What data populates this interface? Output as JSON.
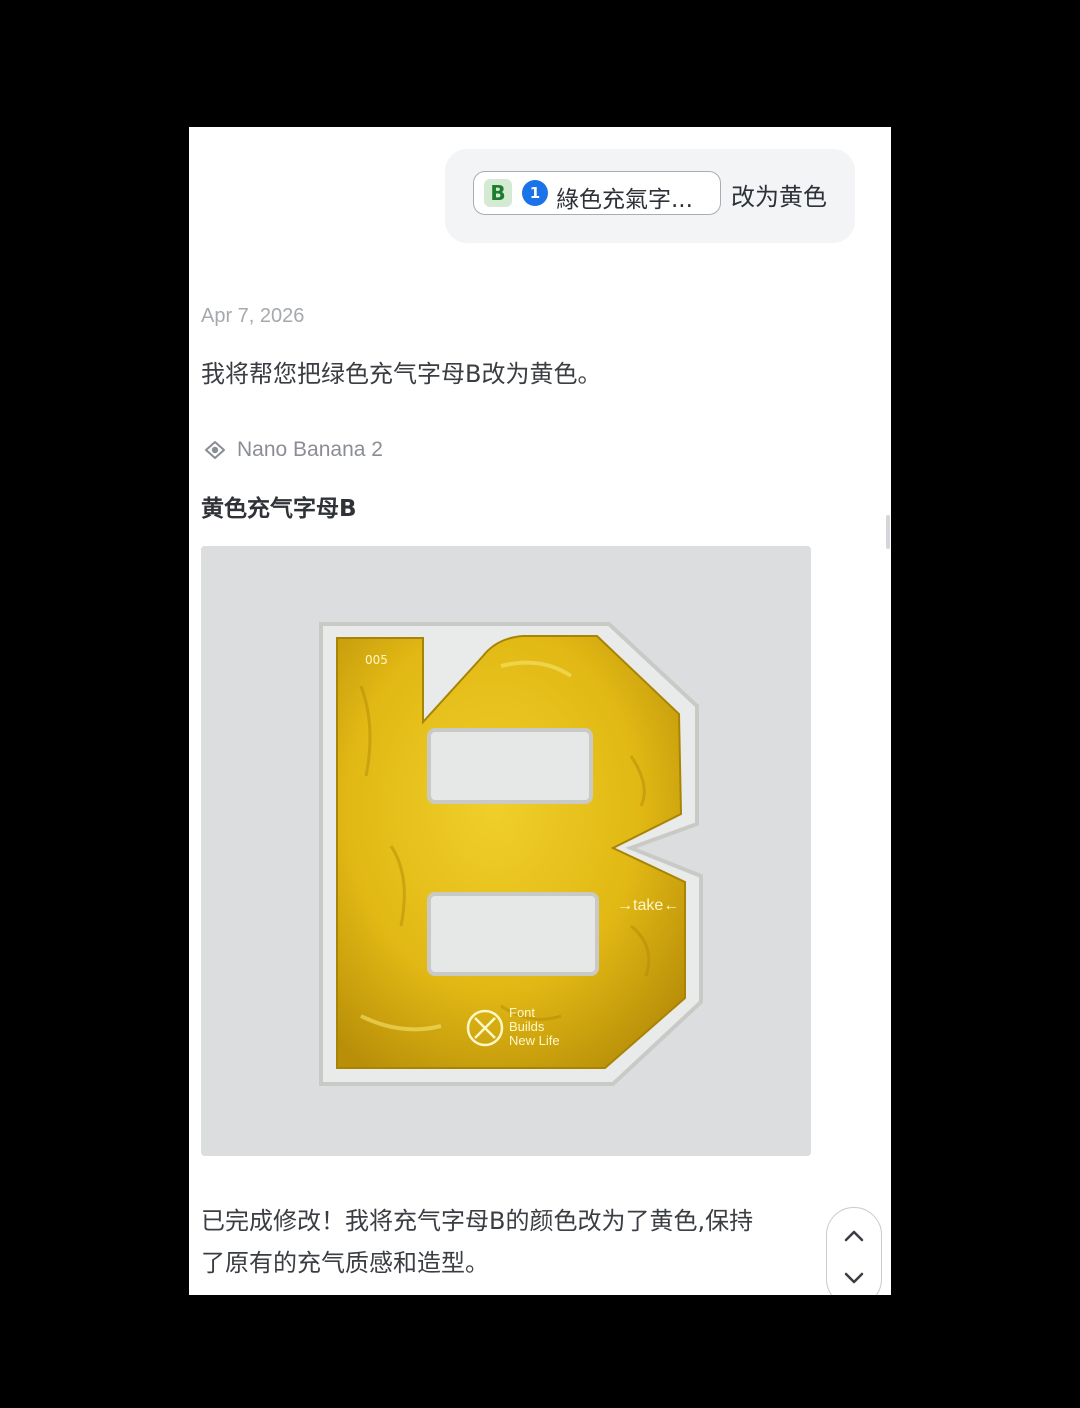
{
  "user_message": {
    "attachment": {
      "thumb_letter": "B",
      "index": "1",
      "label": "綠色充氣字..."
    },
    "text": "改为黄色"
  },
  "assistant": {
    "date": "Apr 7, 2026",
    "reply_intro": "我将帮您把绿色充气字母B改为黄色。",
    "model_name": "Nano Banana 2",
    "image_card_title": "黄色充气字母B",
    "image": {
      "subject": "yellow inflatable letter B",
      "tag_number": "005",
      "tag_take": "→take←",
      "badge_lines": [
        "Font",
        "Builds",
        "New Life"
      ],
      "fill_color": "#e1b814"
    },
    "reply_final_line1": "已完成修改！我将充气字母B的颜色改为了黄色,保持",
    "reply_final_line2": "了原有的充气质感和造型。"
  },
  "controls": {
    "scroll_up_icon": "chevron-up-icon",
    "scroll_down_icon": "chevron-down-icon"
  },
  "colors": {
    "chip_accent": "#1a73e8",
    "thumb_green": "#1c7d2f",
    "balloon_yellow": "#e1b814"
  }
}
